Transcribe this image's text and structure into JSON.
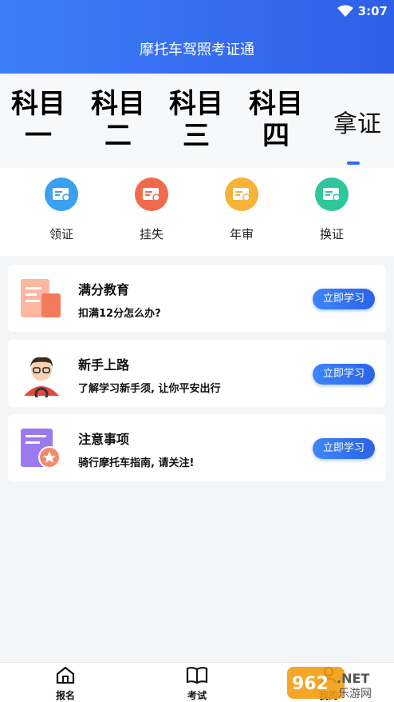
{
  "status": {
    "time": "3:07"
  },
  "app": {
    "title": "摩托车驾照考证通"
  },
  "tabs": [
    {
      "line1": "科目",
      "line2": "一"
    },
    {
      "line1": "科目",
      "line2": "二"
    },
    {
      "line1": "科目",
      "line2": "三"
    },
    {
      "line1": "科目",
      "line2": "四"
    },
    {
      "line1": "拿证"
    }
  ],
  "quick_actions": [
    {
      "label": "领证",
      "color": "#3aa0f0",
      "icon": "license-icon"
    },
    {
      "label": "挂失",
      "color": "#f26a4e",
      "icon": "report-loss-icon"
    },
    {
      "label": "年审",
      "color": "#f7b238",
      "icon": "annual-review-icon"
    },
    {
      "label": "换证",
      "color": "#2ec79c",
      "icon": "renew-license-icon"
    }
  ],
  "cards": [
    {
      "title": "满分教育",
      "subtitle": "扣满12分怎么办?",
      "button": "立即学习"
    },
    {
      "title": "新手上路",
      "subtitle": "了解学习新手须, 让你平安出行",
      "button": "立即学习"
    },
    {
      "title": "注意事项",
      "subtitle": "骑行摩托车指南, 请关注!",
      "button": "立即学习"
    }
  ],
  "bottom_nav": [
    {
      "label": "报名",
      "icon": "home-icon"
    },
    {
      "label": "考试",
      "icon": "book-icon"
    },
    {
      "label": "我的",
      "icon": "profile-icon"
    }
  ],
  "watermark": {
    "text": "962.NET",
    "sub": "乐游网"
  }
}
